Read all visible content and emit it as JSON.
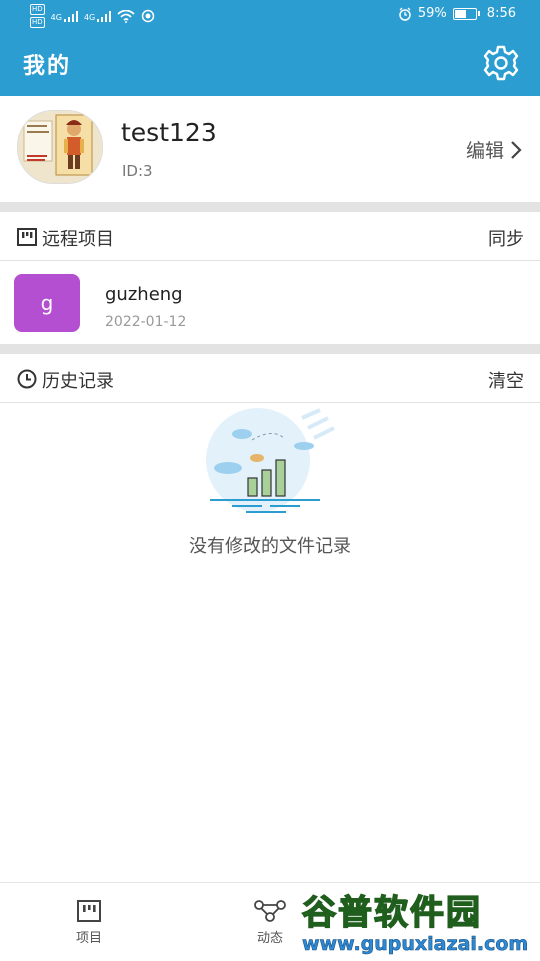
{
  "status_bar": {
    "hd1": "HD",
    "hd2": "HD",
    "net1": "4G",
    "net2": "4G",
    "battery_percent": "59%",
    "battery_level": 0.59,
    "time": "8:56"
  },
  "header": {
    "title": "我的"
  },
  "profile": {
    "username": "test123",
    "id_text": "ID:3",
    "edit_label": "编辑"
  },
  "remote_projects": {
    "title": "远程项目",
    "action": "同步",
    "items": [
      {
        "badge": "g",
        "name": "guzheng",
        "date": "2022-01-12",
        "color": "#b44fd1"
      }
    ]
  },
  "history": {
    "title": "历史记录",
    "action": "清空",
    "empty_text": "没有修改的文件记录"
  },
  "bottom_nav": {
    "items": [
      {
        "label": "项目",
        "icon": "project-icon"
      },
      {
        "label": "动态",
        "icon": "activity-icon"
      }
    ]
  },
  "watermark": {
    "text": "谷普软件园",
    "url": "www.gupuxiazai.com"
  },
  "colors": {
    "primary": "#2b9dd0",
    "divider": "#e3e3e3",
    "project_badge": "#b44fd1"
  }
}
